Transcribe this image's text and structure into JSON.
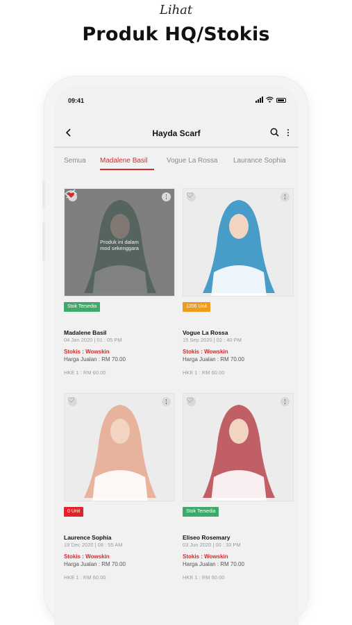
{
  "promo": {
    "subtitle": "Lihat",
    "title": "Produk HQ/Stokis"
  },
  "statusbar": {
    "time": "09:41"
  },
  "appbar": {
    "title": "Hayda Scarf"
  },
  "tabs": [
    "Semua",
    "Madalene Basil",
    "Vogue La Rossa",
    "Laurance Sophia"
  ],
  "active_tab": "Madalene Basil",
  "colors": {
    "accent": "#d62a2a",
    "badge_green": "#3fa86b",
    "badge_orange": "#ef9c1c",
    "badge_red": "#e0242a"
  },
  "products": [
    {
      "name": "Madalene Basil",
      "datetime": "04 Jan 2020 | 01 : 05 PM",
      "badge": "Stok Tersedia",
      "badge_color": "green",
      "stokis": "Stokis : Wowskin",
      "price": "Harga Jualan : RM 70.00",
      "hke": "HKE 1  :  RM 60.00",
      "favorited": true,
      "overlay_line1": "Produk ini dalam",
      "overlay_line2": "mod sekenggara",
      "scarf_color": "#3f7a6a"
    },
    {
      "name": "Vogue La Rossa",
      "datetime": "15 Sep 2020 | 02 : 40 PM",
      "badge": "1206 Unit",
      "badge_color": "orange",
      "stokis": "Stokis : Wowskin",
      "price": "Harga Jualan : RM 70.00",
      "hke": "HKE 1  :  RM 60.00",
      "favorited": false,
      "scarf_color": "#2a8fc1"
    },
    {
      "name": "Laurence Sophia",
      "datetime": "19 Dec 2020 | 08 : 55 AM",
      "badge": "0 Unit",
      "badge_color": "red",
      "stokis": "Stokis : Wowskin",
      "price": "Harga Jualan : RM 70.00",
      "hke": "HKE 1  :  RM 60.00",
      "favorited": false,
      "scarf_color": "#e7a98f"
    },
    {
      "name": "Eliseo Rosemary",
      "datetime": "03 Jun 2020 | 00 : 33 PM",
      "badge": "Stok Tersedia",
      "badge_color": "green",
      "stokis": "Stokis : Wowskin",
      "price": "Harga Jualan : RM 70.00",
      "hke": "HKE 1  :  RM 60.00",
      "favorited": false,
      "scarf_color": "#b8464e"
    }
  ]
}
